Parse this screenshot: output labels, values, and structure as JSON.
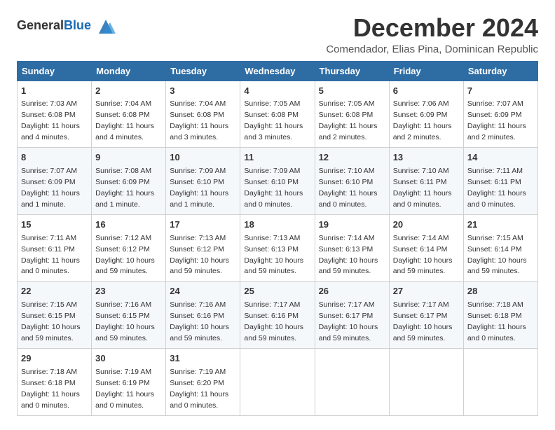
{
  "logo": {
    "general": "General",
    "blue": "Blue"
  },
  "header": {
    "month_title": "December 2024",
    "subtitle": "Comendador, Elias Pina, Dominican Republic"
  },
  "weekdays": [
    "Sunday",
    "Monday",
    "Tuesday",
    "Wednesday",
    "Thursday",
    "Friday",
    "Saturday"
  ],
  "weeks": [
    [
      {
        "day": "1",
        "sunrise": "7:03 AM",
        "sunset": "6:08 PM",
        "daylight": "11 hours and 4 minutes."
      },
      {
        "day": "2",
        "sunrise": "7:04 AM",
        "sunset": "6:08 PM",
        "daylight": "11 hours and 4 minutes."
      },
      {
        "day": "3",
        "sunrise": "7:04 AM",
        "sunset": "6:08 PM",
        "daylight": "11 hours and 3 minutes."
      },
      {
        "day": "4",
        "sunrise": "7:05 AM",
        "sunset": "6:08 PM",
        "daylight": "11 hours and 3 minutes."
      },
      {
        "day": "5",
        "sunrise": "7:05 AM",
        "sunset": "6:08 PM",
        "daylight": "11 hours and 2 minutes."
      },
      {
        "day": "6",
        "sunrise": "7:06 AM",
        "sunset": "6:09 PM",
        "daylight": "11 hours and 2 minutes."
      },
      {
        "day": "7",
        "sunrise": "7:07 AM",
        "sunset": "6:09 PM",
        "daylight": "11 hours and 2 minutes."
      }
    ],
    [
      {
        "day": "8",
        "sunrise": "7:07 AM",
        "sunset": "6:09 PM",
        "daylight": "11 hours and 1 minute."
      },
      {
        "day": "9",
        "sunrise": "7:08 AM",
        "sunset": "6:09 PM",
        "daylight": "11 hours and 1 minute."
      },
      {
        "day": "10",
        "sunrise": "7:09 AM",
        "sunset": "6:10 PM",
        "daylight": "11 hours and 1 minute."
      },
      {
        "day": "11",
        "sunrise": "7:09 AM",
        "sunset": "6:10 PM",
        "daylight": "11 hours and 0 minutes."
      },
      {
        "day": "12",
        "sunrise": "7:10 AM",
        "sunset": "6:10 PM",
        "daylight": "11 hours and 0 minutes."
      },
      {
        "day": "13",
        "sunrise": "7:10 AM",
        "sunset": "6:11 PM",
        "daylight": "11 hours and 0 minutes."
      },
      {
        "day": "14",
        "sunrise": "7:11 AM",
        "sunset": "6:11 PM",
        "daylight": "11 hours and 0 minutes."
      }
    ],
    [
      {
        "day": "15",
        "sunrise": "7:11 AM",
        "sunset": "6:11 PM",
        "daylight": "11 hours and 0 minutes."
      },
      {
        "day": "16",
        "sunrise": "7:12 AM",
        "sunset": "6:12 PM",
        "daylight": "10 hours and 59 minutes."
      },
      {
        "day": "17",
        "sunrise": "7:13 AM",
        "sunset": "6:12 PM",
        "daylight": "10 hours and 59 minutes."
      },
      {
        "day": "18",
        "sunrise": "7:13 AM",
        "sunset": "6:13 PM",
        "daylight": "10 hours and 59 minutes."
      },
      {
        "day": "19",
        "sunrise": "7:14 AM",
        "sunset": "6:13 PM",
        "daylight": "10 hours and 59 minutes."
      },
      {
        "day": "20",
        "sunrise": "7:14 AM",
        "sunset": "6:14 PM",
        "daylight": "10 hours and 59 minutes."
      },
      {
        "day": "21",
        "sunrise": "7:15 AM",
        "sunset": "6:14 PM",
        "daylight": "10 hours and 59 minutes."
      }
    ],
    [
      {
        "day": "22",
        "sunrise": "7:15 AM",
        "sunset": "6:15 PM",
        "daylight": "10 hours and 59 minutes."
      },
      {
        "day": "23",
        "sunrise": "7:16 AM",
        "sunset": "6:15 PM",
        "daylight": "10 hours and 59 minutes."
      },
      {
        "day": "24",
        "sunrise": "7:16 AM",
        "sunset": "6:16 PM",
        "daylight": "10 hours and 59 minutes."
      },
      {
        "day": "25",
        "sunrise": "7:17 AM",
        "sunset": "6:16 PM",
        "daylight": "10 hours and 59 minutes."
      },
      {
        "day": "26",
        "sunrise": "7:17 AM",
        "sunset": "6:17 PM",
        "daylight": "10 hours and 59 minutes."
      },
      {
        "day": "27",
        "sunrise": "7:17 AM",
        "sunset": "6:17 PM",
        "daylight": "10 hours and 59 minutes."
      },
      {
        "day": "28",
        "sunrise": "7:18 AM",
        "sunset": "6:18 PM",
        "daylight": "11 hours and 0 minutes."
      }
    ],
    [
      {
        "day": "29",
        "sunrise": "7:18 AM",
        "sunset": "6:18 PM",
        "daylight": "11 hours and 0 minutes."
      },
      {
        "day": "30",
        "sunrise": "7:19 AM",
        "sunset": "6:19 PM",
        "daylight": "11 hours and 0 minutes."
      },
      {
        "day": "31",
        "sunrise": "7:19 AM",
        "sunset": "6:20 PM",
        "daylight": "11 hours and 0 minutes."
      },
      null,
      null,
      null,
      null
    ]
  ],
  "labels": {
    "sunrise": "Sunrise:",
    "sunset": "Sunset:",
    "daylight": "Daylight:"
  }
}
